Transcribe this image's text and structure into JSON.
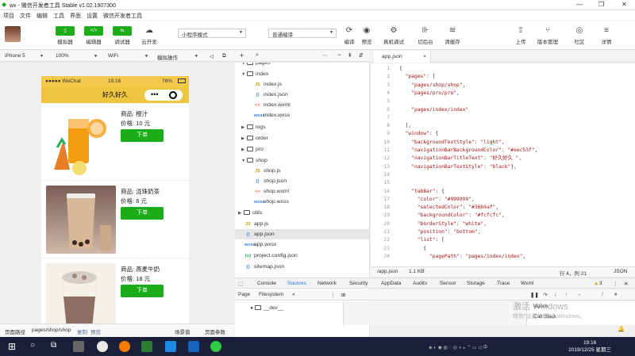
{
  "window": {
    "title": "wx - 微信开发者工具 Stable v1.02.1907300",
    "controls": [
      "—",
      "❐",
      "✕"
    ]
  },
  "menu": [
    "项目",
    "文件",
    "编辑",
    "工具",
    "界面",
    "设置",
    "微信开发者工具"
  ],
  "toolbar": {
    "buttons": {
      "simulator": {
        "label": "模拟器",
        "icon": "phone-icon"
      },
      "editor": {
        "label": "编辑器",
        "icon": "code-icon",
        "glyph": "</>"
      },
      "debugger": {
        "label": "调试器",
        "icon": "debug-icon"
      },
      "cloud": {
        "label": "云开发",
        "icon": "cloud-dev-icon"
      },
      "compile": {
        "label": "编译",
        "icon": "refresh-icon"
      },
      "preview": {
        "label": "预览",
        "icon": "eye-icon"
      },
      "remote_debug": {
        "label": "真机调试",
        "icon": "remote-debug-icon"
      },
      "background": {
        "label": "切后台",
        "icon": "background-icon"
      },
      "clear_cache": {
        "label": "清缓存",
        "icon": "layers-icon"
      },
      "upload": {
        "label": "上传",
        "icon": "upload-icon"
      },
      "version": {
        "label": "版本管理",
        "icon": "version-icon"
      },
      "community": {
        "label": "社区",
        "icon": "community-icon"
      },
      "details": {
        "label": "详情",
        "icon": "menu-icon"
      }
    },
    "mode_select": "小程序模式",
    "compile_select": "普通编译"
  },
  "simulator": {
    "device": "iPhone 5",
    "zoom": "100%",
    "network": "WiFi",
    "operation": "模拟操作",
    "status": {
      "carrier": "●●●●● WeChat",
      "time": "19:16",
      "battery": "78%"
    },
    "nav_title": "好久好久",
    "products": [
      {
        "name": "商品: 橙汁",
        "price": "价格:  10 元",
        "buy": "下单"
      },
      {
        "name": "商品: 泷珠奶茶",
        "price": "价格:  8 元",
        "buy": "下单"
      },
      {
        "name": "商品: 燕麦牛奶",
        "price": "价格:  18 元",
        "buy": "下单"
      }
    ],
    "footer": {
      "path_label": "页面路径",
      "path": "pages/shop/shop",
      "copy": "复制",
      "preview": "预览",
      "scene": "场景值",
      "params": "页面参数"
    }
  },
  "tree": [
    {
      "label": "pages",
      "type": "folder",
      "depth": 0
    },
    {
      "label": "index",
      "type": "folder",
      "depth": 1,
      "open": true
    },
    {
      "label": "index.js",
      "type": "js",
      "depth": 2
    },
    {
      "label": "index.json",
      "type": "json",
      "depth": 2
    },
    {
      "label": "index.wxml",
      "type": "wxml",
      "depth": 2
    },
    {
      "label": "index.wxss",
      "type": "wxss",
      "depth": 2
    },
    {
      "label": "logs",
      "type": "folder",
      "depth": 1
    },
    {
      "label": "order",
      "type": "folder",
      "depth": 1
    },
    {
      "label": "pro",
      "type": "folder",
      "depth": 1
    },
    {
      "label": "shop",
      "type": "folder",
      "depth": 1,
      "open": true
    },
    {
      "label": "shop.js",
      "type": "js",
      "depth": 2
    },
    {
      "label": "shop.json",
      "type": "json",
      "depth": 2
    },
    {
      "label": "shop.wxml",
      "type": "wxml",
      "depth": 2
    },
    {
      "label": "shop.wxss",
      "type": "wxss",
      "depth": 2
    },
    {
      "label": "utils",
      "type": "folder",
      "depth": 0
    },
    {
      "label": "app.js",
      "type": "js",
      "depth": 0
    },
    {
      "label": "app.json",
      "type": "json",
      "depth": 0,
      "selected": true
    },
    {
      "label": "app.wxss",
      "type": "wxss",
      "depth": 0
    },
    {
      "label": "project.config.json",
      "type": "cfg",
      "depth": 0
    },
    {
      "label": "sitemap.json",
      "type": "json",
      "depth": 0
    }
  ],
  "editor": {
    "tab": "app.json",
    "lines": [
      "{",
      "  \"pages\": [",
      "    \"pages/shop/shop\",",
      "    \"pages/pro/pro\",",
      "",
      "    \"pages/index/index\"",
      "",
      "  ],",
      "  \"window\": {",
      "    \"backgroundTextStyle\": \"light\",",
      "    \"navigationBarBackgroundColor\": \"#eec53f\",",
      "    \"navigationBarTitleText\": \"好久好久 \",",
      "    \"navigationBarTextStyle\": \"black\"},",
      "",
      "",
      "    \"tabBar\": {",
      "      \"color\": \"#999999\",",
      "      \"selectedColor\": \"#36b9af\",",
      "      \"backgroundColor\": \"#fcfcfc\",",
      "      \"borderStyle\": \"white\",",
      "      \"position\": \"bottom\",",
      "      \"list\": [",
      "        {",
      "          \"pagePath\": \"pages/index/index\","
    ],
    "status": {
      "file": "/app.json",
      "size": "1.1 KB",
      "pos": "行 4，列 21",
      "lang": "JSON"
    }
  },
  "devtools": {
    "tabs": [
      "Console",
      "Sources",
      "Network",
      "Security",
      "AppData",
      "Audits",
      "Sensor",
      "Storage",
      "Trace",
      "Wxml"
    ],
    "active": "Sources",
    "warn_count": "3",
    "sub_tabs": [
      "Page",
      "Filesystem"
    ],
    "tree_item": "__dev__",
    "watch": "Watch",
    "callstack": "Call Stack"
  },
  "watermark": {
    "line1": "激活 Windows",
    "line2": "转到\"设置\"以激活 Windows。"
  },
  "taskbar": {
    "time": "19:16",
    "date": "2019/12/25 星期三"
  },
  "colors": {
    "green": "#1aad19",
    "nav_yellow": "#eec53f",
    "taskbar": "#1b1f3a"
  }
}
